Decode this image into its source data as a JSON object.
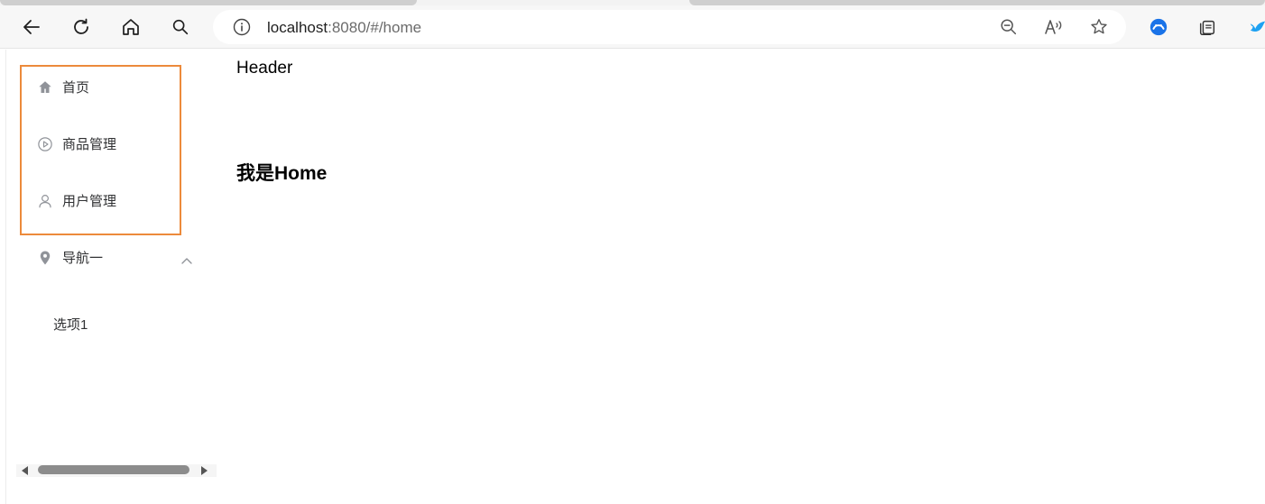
{
  "browser": {
    "url_host": "localhost",
    "url_rest": ":8080/#/home"
  },
  "sidebar": {
    "items": [
      {
        "label": "首页",
        "icon": "home-icon"
      },
      {
        "label": "商品管理",
        "icon": "play-circle-icon"
      },
      {
        "label": "用户管理",
        "icon": "user-icon"
      }
    ],
    "submenu": {
      "label": "导航一",
      "icon": "location-icon",
      "expanded": true,
      "items": [
        {
          "label": "选项1"
        }
      ]
    }
  },
  "main": {
    "header": "Header",
    "heading": "我是Home"
  },
  "colors": {
    "highlight": "#ec8a3b",
    "menu_text": "#303133",
    "icon": "#909399"
  }
}
